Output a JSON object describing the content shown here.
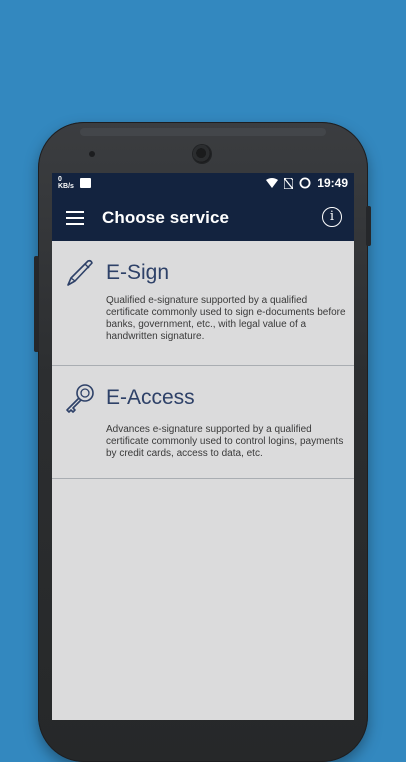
{
  "status_bar": {
    "speed_value": "0",
    "speed_unit": "KB/s",
    "time": "19:49"
  },
  "app_bar": {
    "title": "Choose service"
  },
  "services": [
    {
      "title": "E-Sign",
      "icon": "pen-icon",
      "description": "Qualified e-signature supported by a qualified certificate commonly used to sign e-documents before banks, government, etc., with legal value of a handwritten signature."
    },
    {
      "title": "E-Access",
      "icon": "key-icon",
      "description": "Advances e-signature supported by a qualified certificate commonly used to control logins, payments by credit cards, access to data, etc."
    }
  ],
  "colors": {
    "background": "#3388bf",
    "app_bar": "#13233f",
    "accent": "#2e4168",
    "content": "#dbdbdc"
  }
}
